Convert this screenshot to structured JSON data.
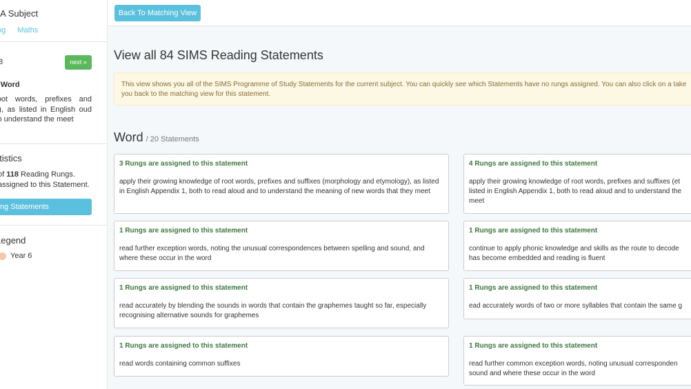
{
  "sidebar": {
    "title": "o A Subject",
    "tabs": [
      "ng",
      "Maths"
    ],
    "statement_number": "8",
    "next_label": "next »",
    "strand": "- Word",
    "description": "of root words, prefixes and ology), as listed in English oud and to understand the meet",
    "stats_title": "atistics",
    "stats_line1_prefix": "of ",
    "stats_line1_count": "118",
    "stats_line1_suffix": " Reading Rungs.",
    "stats_line2": "assigned to this Statement.",
    "stats_button": "ng Statements",
    "legend_title": "Legend",
    "legend_item": "Year 6",
    "legend_color": "#f6c8a5"
  },
  "main": {
    "back_button": "Back To Matching View",
    "page_title": "View all 84 SIMS Reading Statements",
    "alert_text": "This view shows you all of the SIMS Programme of Study Statements for the current subject. You can quickly see which Statements have no rungs assigned. You can also click on a take you back to the matching view for this statement.",
    "section_title": "Word",
    "section_count": "/ 20 Statements"
  },
  "cards": [
    {
      "head": "3 Rungs are assigned to this statement",
      "body": "apply their growing knowledge of root words, prefixes and suffixes (morphology and etymology), as listed in English Appendix 1, both to read aloud and to understand the meaning of new words that they meet"
    },
    {
      "head": "4 Rungs are assigned to this statement",
      "body": "apply their growing knowledge of root words, prefixes and suffixes (et\nlisted in English Appendix 1, both to read aloud and to understand the\nmeet"
    },
    {
      "head": "1 Rungs are assigned to this statement",
      "body": "read further exception words, noting the unusual correspondences between spelling and sound, and where these occur in the word"
    },
    {
      "head": "1 Rungs are assigned to this statement",
      "body": "continue to apply phonic knowledge and skills as the route to decode\nhas become embedded and reading is fluent"
    },
    {
      "head": "1 Rungs are assigned to this statement",
      "body": "read accurately by blending the sounds in words that contain the graphemes taught so far, especially recognising alternative sounds for graphemes"
    },
    {
      "head": "1 Rungs are assigned to this statement",
      "body": "ead accurately words of two or more syllables that contain the same g"
    },
    {
      "head": "1 Rungs are assigned to this statement",
      "body": "read words containing common suffixes"
    },
    {
      "head": "1 Rungs are assigned to this statement",
      "body": "read further common exception words, noting unusual corresponden\nsound and where these occur in the word"
    }
  ],
  "colors": {
    "accent_blue": "#5bc0de",
    "next_green": "#5cb85c",
    "rung_green": "#3c763d",
    "alert_bg": "#fcf8e3"
  }
}
